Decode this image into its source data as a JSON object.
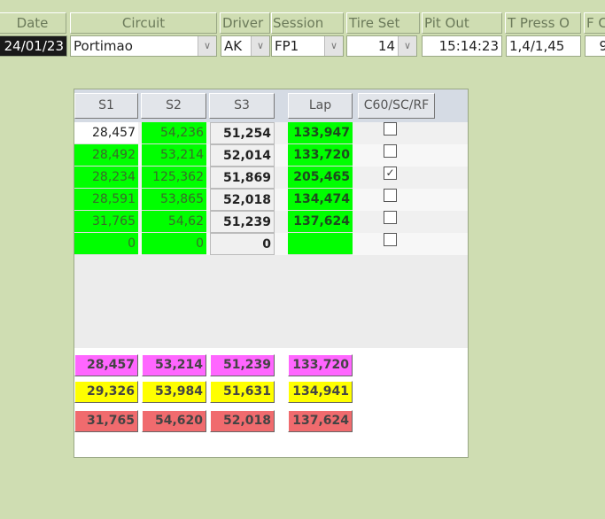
{
  "header": {
    "labels": [
      "Date",
      "Circuit",
      "Driver",
      "Session",
      "Tire Set",
      "Pit Out",
      "T Press O",
      "F C"
    ],
    "date": "24/01/23",
    "circuit": "Portimao",
    "driver": "AK",
    "session": "FP1",
    "tire_set": "14",
    "pit_out": "15:14:23",
    "t_press": "1,4/1,45",
    "f": "9"
  },
  "table": {
    "columns": [
      "S1",
      "S2",
      "S3",
      "Lap",
      "C60/SC/RF"
    ],
    "rows": [
      {
        "s1": "28,457",
        "s2": "54,236",
        "s3": "51,254",
        "lap": "133,947",
        "flag": false
      },
      {
        "s1": "28,492",
        "s2": "53,214",
        "s3": "52,014",
        "lap": "133,720",
        "flag": false
      },
      {
        "s1": "28,234",
        "s2": "125,362",
        "s3": "51,869",
        "lap": "205,465",
        "flag": true
      },
      {
        "s1": "28,591",
        "s2": "53,865",
        "s3": "52,018",
        "lap": "134,474",
        "flag": false
      },
      {
        "s1": "31,765",
        "s2": "54,62",
        "s3": "51,239",
        "lap": "137,624",
        "flag": false
      },
      {
        "s1": "0",
        "s2": "0",
        "s3": "0",
        "lap": "",
        "flag": false
      }
    ]
  },
  "summary": [
    {
      "color": "#ff66ff",
      "values": [
        "28,457",
        "53,214",
        "51,239",
        "133,720"
      ]
    },
    {
      "color": "#ffff00",
      "values": [
        "29,326",
        "53,984",
        "51,631",
        "134,941"
      ]
    },
    {
      "color": "#f06b6e",
      "values": [
        "31,765",
        "54,620",
        "52,018",
        "137,624"
      ]
    }
  ]
}
